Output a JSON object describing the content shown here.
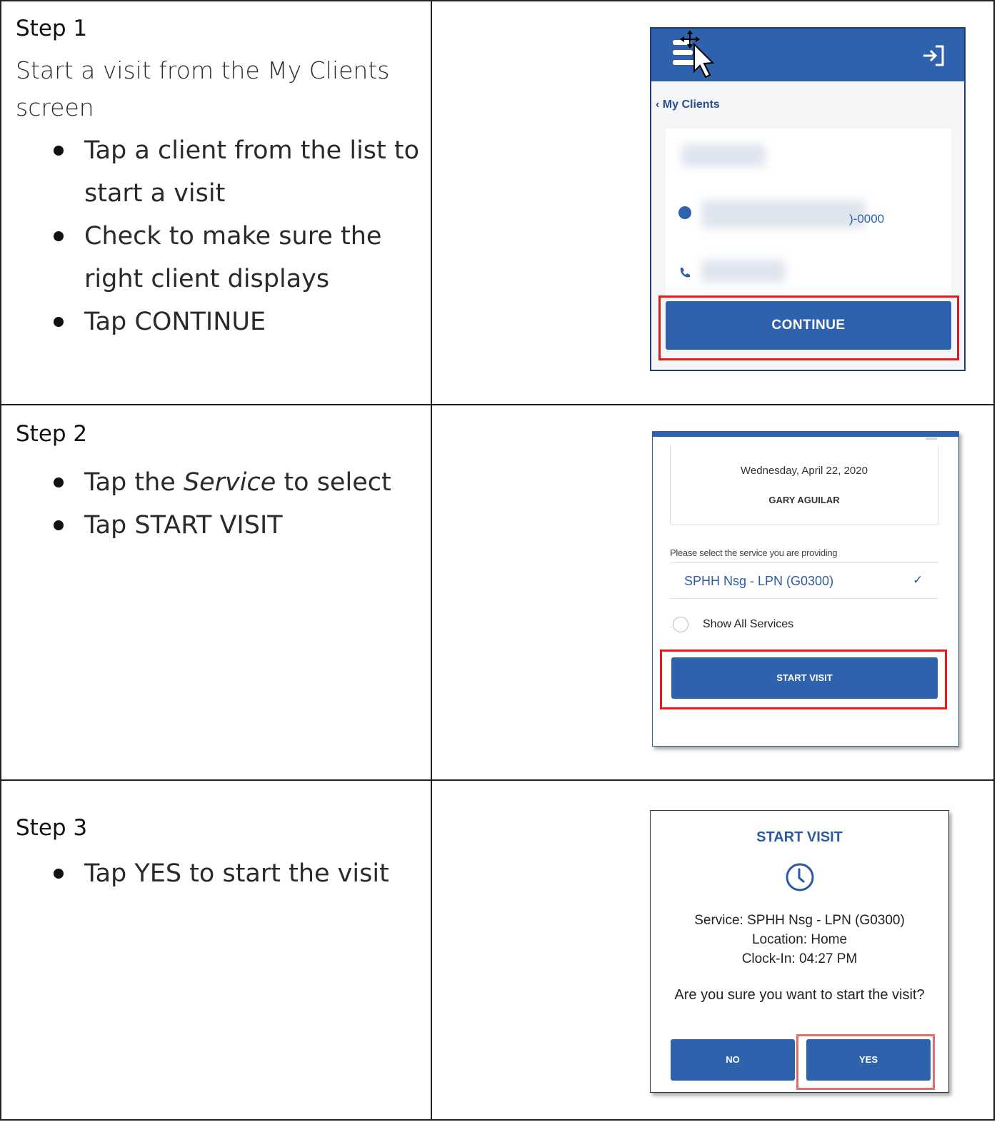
{
  "steps": [
    {
      "title": "Step 1",
      "intro": "Start a visit from the My Clients screen",
      "bullets": [
        "Tap a client from the list to start a visit",
        "Check to make sure the right client displays",
        "Tap CONTINUE"
      ]
    },
    {
      "title": "Step 2",
      "bullets_before_em": "Tap the ",
      "bullet_em": "Service",
      "bullets_after_em": " to select",
      "bullet2": "Tap START VISIT"
    },
    {
      "title": "Step 3",
      "bullets": [
        "Tap YES to start the visit"
      ]
    }
  ],
  "screen1": {
    "back_link": "My Clients",
    "phone_suffix": ")-0000",
    "continue_label": "CONTINUE",
    "icons": [
      "menu-icon",
      "move-cursor-icon",
      "logout-icon",
      "navigation-icon",
      "phone-icon"
    ]
  },
  "screen2": {
    "date": "Wednesday, April 22, 2020",
    "client_name": "GARY AGUILAR",
    "prompt": "Please select the service you are providing",
    "service_option": "SPHH Nsg - LPN (G0300)",
    "show_all_label": "Show All Services",
    "start_label": "START VISIT",
    "icons": [
      "check-icon",
      "radio-icon"
    ]
  },
  "screen3": {
    "title": "START VISIT",
    "service_line": "Service: SPHH Nsg - LPN (G0300)",
    "location_line": "Location: Home",
    "clockin_line": "Clock-In: 04:27 PM",
    "question": "Are you sure you want to start the visit?",
    "no_label": "NO",
    "yes_label": "YES",
    "icons": [
      "clock-icon"
    ]
  },
  "colors": {
    "brand_blue": "#2e62ac",
    "highlight_red": "#e21c1c"
  }
}
